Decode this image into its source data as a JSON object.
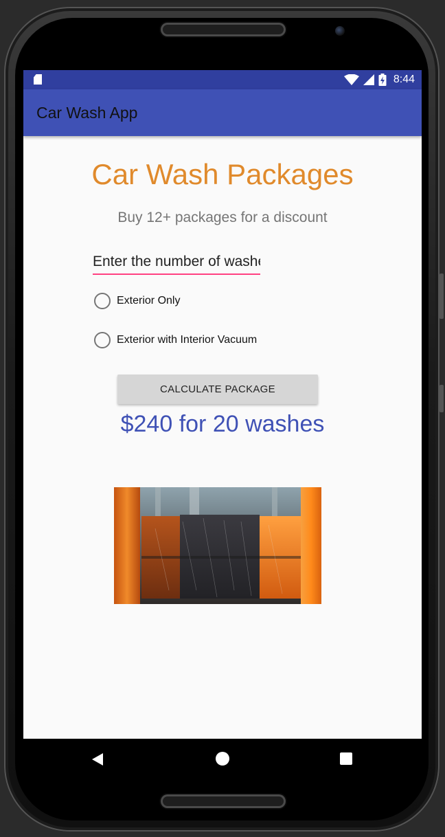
{
  "status_bar": {
    "time": "8:44",
    "icons": [
      "sd-card-icon",
      "wifi-icon",
      "signal-icon",
      "battery-charging-icon"
    ]
  },
  "app_bar": {
    "title": "Car Wash App"
  },
  "main": {
    "heading": "Car Wash Packages",
    "subheading": "Buy 12+ packages for a discount",
    "washes_input": {
      "placeholder": "Enter the number of washes",
      "value": ""
    },
    "options": [
      {
        "label": "Exterior Only",
        "selected": false
      },
      {
        "label": "Exterior with Interior Vacuum",
        "selected": false
      }
    ],
    "calculate_button": "CALCULATE PACKAGE",
    "result": "$240 for 20 washes",
    "image_alt": "car wash brushes"
  },
  "nav_bar": {
    "icons": [
      "back-icon",
      "home-icon",
      "recents-icon"
    ]
  },
  "colors": {
    "status_bar": "#303f9f",
    "app_bar": "#3f51b5",
    "heading": "#e08a2c",
    "accent": "#ff4081",
    "result": "#3f51b5",
    "button": "#d6d6d6"
  }
}
